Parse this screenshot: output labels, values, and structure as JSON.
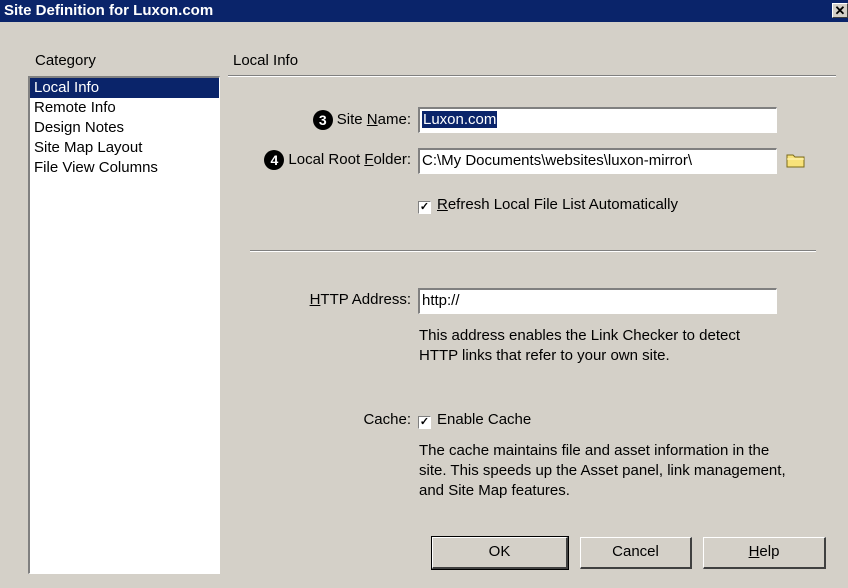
{
  "window": {
    "title": "Site Definition for Luxon.com",
    "close_glyph": "✕"
  },
  "category": {
    "heading": "Category",
    "items": [
      {
        "label": "Local Info",
        "selected": true
      },
      {
        "label": "Remote Info"
      },
      {
        "label": "Design Notes"
      },
      {
        "label": "Site Map Layout"
      },
      {
        "label": "File View Columns"
      }
    ]
  },
  "panel": {
    "heading": "Local Info",
    "site_name": {
      "callout": "3",
      "label_pre": "Site ",
      "label_u": "N",
      "label_post": "ame:",
      "value": "Luxon.com"
    },
    "local_root": {
      "callout": "4",
      "label_pre": "Local Root ",
      "label_u": "F",
      "label_post": "older:",
      "value": "C:\\My Documents\\websites\\luxon-mirror\\"
    },
    "refresh": {
      "checked": "✓",
      "label_u": "R",
      "label_post": "efresh Local File List Automatically"
    },
    "http": {
      "label_u": "H",
      "label_post": "TTP Address:",
      "value": "http://",
      "desc": "This address enables the Link Checker to detect HTTP links that refer to your own site."
    },
    "cache": {
      "label": "Cache:",
      "checked": "✓",
      "check_label": "Enable Cache",
      "desc": "The cache maintains file and asset information in the site.  This speeds up the Asset panel, link management, and Site Map features."
    }
  },
  "buttons": {
    "ok": "OK",
    "cancel": "Cancel",
    "help_u": "H",
    "help_post": "elp"
  }
}
